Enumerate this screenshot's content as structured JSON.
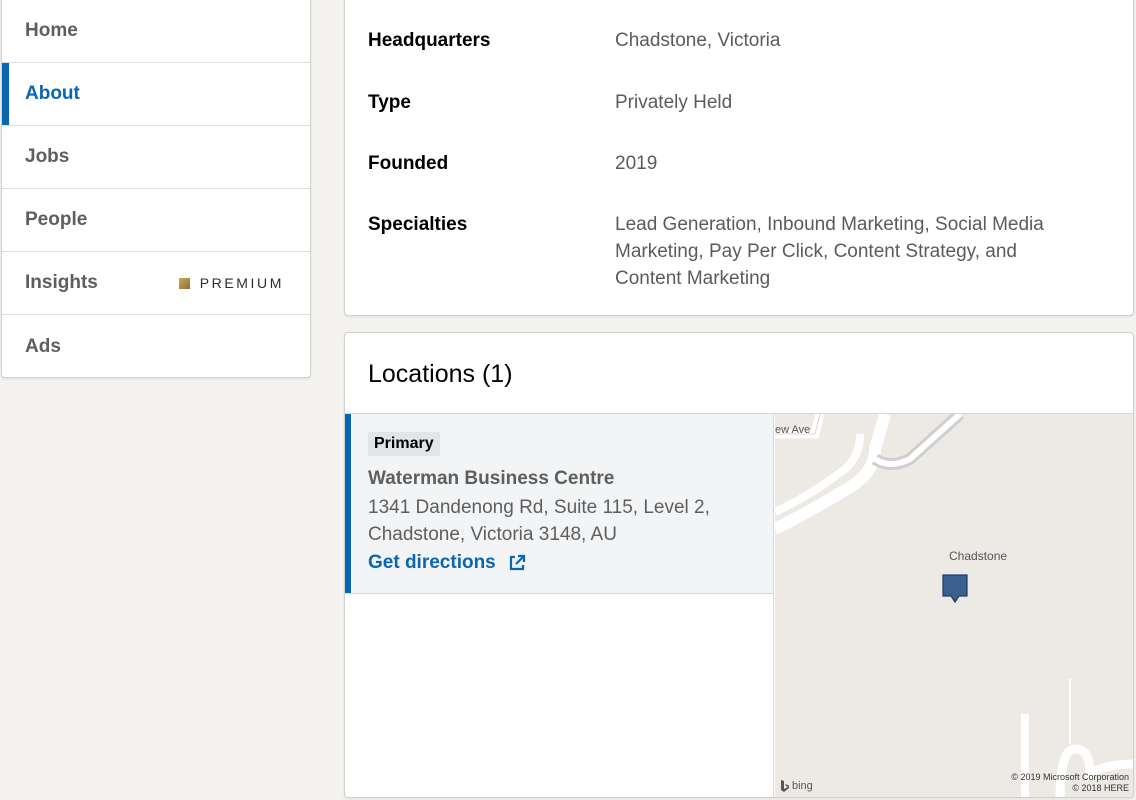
{
  "nav": {
    "items": [
      {
        "label": "Home"
      },
      {
        "label": "About"
      },
      {
        "label": "Jobs"
      },
      {
        "label": "People"
      },
      {
        "label": "Insights"
      },
      {
        "label": "Ads"
      }
    ],
    "active": "About",
    "premium_label": "PREMIUM"
  },
  "overview": {
    "rows": [
      {
        "label": "Headquarters",
        "value": "Chadstone, Victoria"
      },
      {
        "label": "Type",
        "value": "Privately Held"
      },
      {
        "label": "Founded",
        "value": "2019"
      },
      {
        "label": "Specialties",
        "value": "Lead Generation, Inbound Marketing, Social Media Marketing, Pay Per Click, Content Strategy, and Content Marketing"
      }
    ]
  },
  "locations": {
    "title": "Locations (1)",
    "items": [
      {
        "badge": "Primary",
        "name": "Waterman Business Centre",
        "address": "1341 Dandenong Rd, Suite 115, Level 2, Chadstone, Victoria 3148, AU",
        "link_label": "Get directions",
        "link_icon": "external-link-icon"
      }
    ],
    "map": {
      "street_label": "ew Ave",
      "place_label": "Chadstone",
      "provider": "bing",
      "copyright_1": "© 2019 Microsoft Corporation",
      "copyright_2": "© 2018 HERE",
      "pin_color": "#3b5f8f"
    }
  },
  "colors": {
    "accent": "#0b66b0",
    "background": "#f3f2ef",
    "premium_gold": "#b8954a"
  }
}
